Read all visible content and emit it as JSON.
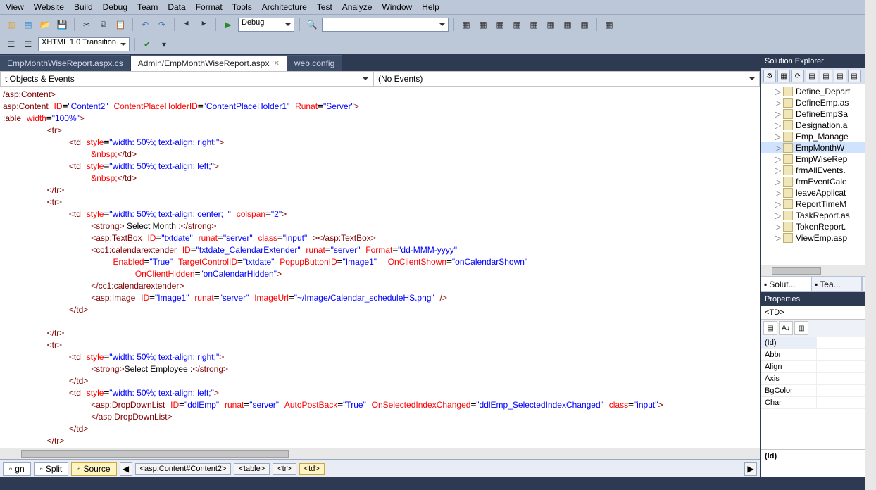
{
  "menus": [
    "View",
    "Website",
    "Build",
    "Debug",
    "Team",
    "Data",
    "Format",
    "Tools",
    "Architecture",
    "Test",
    "Analyze",
    "Window",
    "Help"
  ],
  "toolbar1": {
    "config_combo": "Debug",
    "doctype_combo": "XHTML 1.0 Transition"
  },
  "tabs": [
    {
      "label": "EmpMonthWiseReport.aspx.cs",
      "active": false
    },
    {
      "label": "Admin/EmpMonthWiseReport.aspx",
      "active": true
    },
    {
      "label": "web.config",
      "active": false
    }
  ],
  "dd_left": "t Objects & Events",
  "dd_right": "(No Events)",
  "bottom": {
    "modes": [
      "gn",
      "Split",
      "Source"
    ],
    "active_mode": 2,
    "crumbs": [
      "<asp:Content#Content2>",
      "<table>",
      "<tr>",
      "<td>"
    ],
    "sel_crumb": 3
  },
  "solution": {
    "title": "Solution Explorer",
    "items": [
      "Define_Depart",
      "DefineEmp.as",
      "DefineEmpSa",
      "Designation.a",
      "Emp_Manage",
      "EmpMonthW",
      "EmpWiseRep",
      "frmAllEvents.",
      "frmEventCale",
      "leaveApplicat",
      "ReportTimeM",
      "TaskReport.as",
      "TokenReport.",
      "ViewEmp.asp"
    ],
    "selected": 5,
    "tabs": [
      "Solut...",
      "Tea..."
    ],
    "active_tab": 0
  },
  "properties": {
    "title": "Properties",
    "object": "<TD>",
    "rows": [
      "(Id)",
      "Abbr",
      "Align",
      "Axis",
      "BgColor",
      "Char"
    ],
    "selected": 0,
    "desc": "(Id)"
  },
  "status": {
    "left": "",
    "right": ""
  }
}
